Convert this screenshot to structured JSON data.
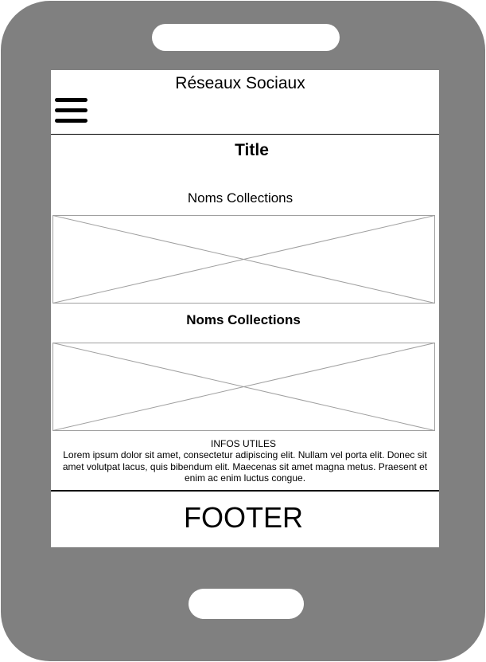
{
  "header": {
    "title": "Réseaux Sociaux",
    "menu_icon": "hamburger-menu-icon"
  },
  "main": {
    "title": "Title",
    "collections": [
      {
        "name": "Noms Collections",
        "image": "image-placeholder"
      },
      {
        "name": "Noms Collections",
        "image": "image-placeholder"
      }
    ],
    "infos": {
      "title": "INFOS UTILES",
      "text": "Lorem ipsum dolor sit amet, consectetur adipiscing elit. Nullam vel porta elit. Donec sit amet volutpat lacus, quis bibendum elit. Maecenas sit amet magna metus. Praesent et enim ac enim luctus congue."
    }
  },
  "footer": {
    "label": "FOOTER"
  },
  "colors": {
    "device_frame": "#808080",
    "screen_background": "#ffffff",
    "placeholder_stroke": "#a0a0a0"
  }
}
